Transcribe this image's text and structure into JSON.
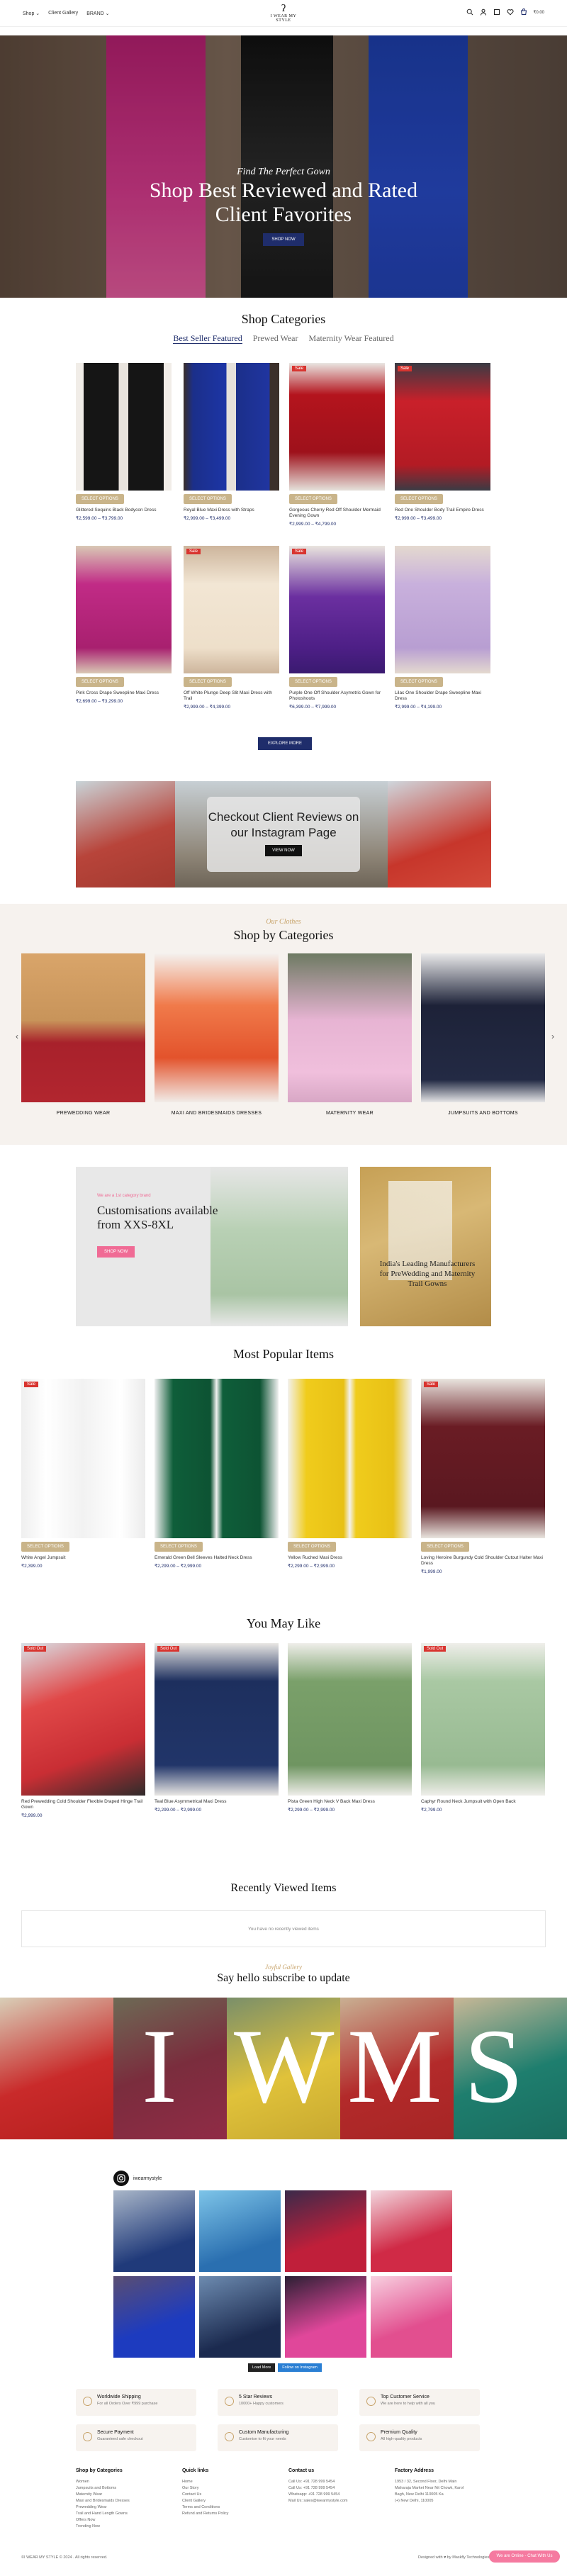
{
  "header": {
    "nav": [
      "Shop ⌄",
      "Client Gallery",
      "BRAND ⌄"
    ],
    "logo_word": "I WEAR MY STYLE",
    "cart_amount": "₹0.00"
  },
  "hero": {
    "script": "Find The Perfect Gown",
    "title_line1": "Shop Best Reviewed and Rated",
    "title_line2": "Client Favorites",
    "button": "SHOP NOW"
  },
  "shop_categories": {
    "title": "Shop Categories",
    "tabs": [
      "Best Seller Featured",
      "Prewed Wear",
      "Maternity Wear Featured"
    ],
    "products": [
      {
        "name": "Glittered Sequins Black Bodycon Dress",
        "price": "₹2,599.00 – ₹3,799.00",
        "badge": ""
      },
      {
        "name": "Royal Blue Maxi Dress with Straps",
        "price": "₹2,999.00 – ₹3,499.00",
        "badge": ""
      },
      {
        "name": "Gorgeous Cherry Red Off Shoulder Mermaid Evening Gown",
        "price": "₹2,999.00 – ₹4,799.00",
        "badge": "Sale"
      },
      {
        "name": "Red One Shoulder Body Trail Empire Dress",
        "price": "₹2,999.00 – ₹3,499.00",
        "badge": "Sale"
      },
      {
        "name": "Pink Cross Drape Sweepline Maxi Dress",
        "price": "₹2,699.00 – ₹3,299.00",
        "badge": ""
      },
      {
        "name": "Off White Plunge Deep Slit Maxi Dress with Trail",
        "price": "₹2,999.00 – ₹4,399.00",
        "badge": "Sale"
      },
      {
        "name": "Purple One Off Shoulder Asymetric Gown for Photoshoots",
        "price": "₹6,399.00 – ₹7,999.00",
        "badge": "Sale"
      },
      {
        "name": "Lilac One Shoulder Drape Sweepline Maxi Dress",
        "price": "₹2,999.00 – ₹4,199.00",
        "badge": ""
      }
    ],
    "select_label": "SELECT OPTIONS",
    "explore_button": "EXPLORE MORE"
  },
  "insta_banner": {
    "title": "Checkout Client Reviews on our Instagram Page",
    "button": "VIEW NOW"
  },
  "shop_by_categories": {
    "script": "Our Clothes",
    "title": "Shop by Categories",
    "items": [
      "PREWEDDING WEAR",
      "MAXI AND BRIDESMAIDS DRESSES",
      "MATERNITY WEAR",
      "JUMPSUITS AND BOTTOMS"
    ]
  },
  "promo": {
    "tag": "We are a 1st category brand",
    "title_line1": "Customisations available",
    "title_line2": "from XXS-8XL",
    "button": "SHOP NOW",
    "side_text": "India's Leading Manufacturers for PreWedding and Maternity Trail Gowns"
  },
  "popular": {
    "title": "Most Popular Items",
    "products": [
      {
        "name": "White Angel Jumpsuit",
        "price": "₹2,399.00",
        "badge": "Sale"
      },
      {
        "name": "Emerald Green Bell Sleeves Halted Neck Dress",
        "price": "₹2,299.00 – ₹2,999.00",
        "badge": ""
      },
      {
        "name": "Yellow Ruched Maxi Dress",
        "price": "₹2,299.00 – ₹2,999.00",
        "badge": ""
      },
      {
        "name": "Loving Heroine Burgundy Cold Shoulder Cutout Halter Maxi Dress",
        "price": "₹1,999.00",
        "badge": "Sale"
      }
    ]
  },
  "you_may_like": {
    "title": "You May Like",
    "products": [
      {
        "name": "Red Prewedding Cold Shoulder Flexible Draped Hinge Trail Gown",
        "price": "₹2,999.00",
        "badge": "Sold Out"
      },
      {
        "name": "Teal Blue Asymmetrical Maxi Dress",
        "price": "₹2,299.00 – ₹2,999.00",
        "badge": "Sold Out"
      },
      {
        "name": "Pista Green High Neck V Back Maxi Dress",
        "price": "₹2,299.00 – ₹2,999.00",
        "badge": ""
      },
      {
        "name": "Caphyr Round Neck Jumpsuit with Open Back",
        "price": "₹2,799.00",
        "badge": "Sold Out"
      }
    ]
  },
  "recently_viewed": {
    "title": "Recently Viewed Items",
    "empty": "You have no recently viewed items"
  },
  "subscribe": {
    "script": "Joyful Gallery",
    "title": "Say hello subscribe to update",
    "letters": [
      "I",
      "W",
      "M",
      "S"
    ]
  },
  "instagram": {
    "handle": "iwearmystyle",
    "load_more": "Load More",
    "follow": "Follow on Instagram"
  },
  "features": [
    {
      "title": "Worldwide Shipping",
      "desc": "For all Orders Over ₹999 purchase"
    },
    {
      "title": "5 Star Reviews",
      "desc": "10000+ Happy customers"
    },
    {
      "title": "Top Customer Service",
      "desc": "We are here to help with all you"
    },
    {
      "title": "Secure Payment",
      "desc": "Guaranteed safe checkout"
    },
    {
      "title": "Custom Manufacturing",
      "desc": "Customise to fit your needs"
    },
    {
      "title": "Premium Quality",
      "desc": "All high-quality products"
    }
  ],
  "footer": {
    "cols": [
      {
        "title": "Shop by Categories",
        "items": [
          "Women",
          "Jumpsuits and Bottoms",
          "Maternity Wear",
          "Maxi and Bridesmaids Dresses",
          "Prewedding Wear",
          "Trail and Hand Length Gowns",
          "Offers Now",
          "Trending Now"
        ]
      },
      {
        "title": "Quick links",
        "items": [
          "Home",
          "Our Story",
          "Contact Us",
          "Client Gallery",
          "Terms and Conditions",
          "Refund and Returns Policy"
        ]
      },
      {
        "title": "Contact us",
        "items": [
          "Call Us: +91 728 999 5454",
          "Call Us: +91 728 999 5454",
          "Whatsapp: +91 728 999 5454",
          "Mail Us: sales@iwearmystyle.com"
        ]
      },
      {
        "title": "Factory Address",
        "items": [
          "1953 / 32, Second Floor, Delhi Main",
          "Maharaja Market Near Nit Chowk, Karol",
          "Bagh, New Delhi 110005 Ka",
          "(+) New Delhi, 110005"
        ]
      }
    ],
    "copyright": "©I WEAR MY STYLE © 2024 . All rights reserved.",
    "credit": "Designed with ♥ by Maskfly Technologies",
    "chat": "We are Online - Chat With Us"
  }
}
